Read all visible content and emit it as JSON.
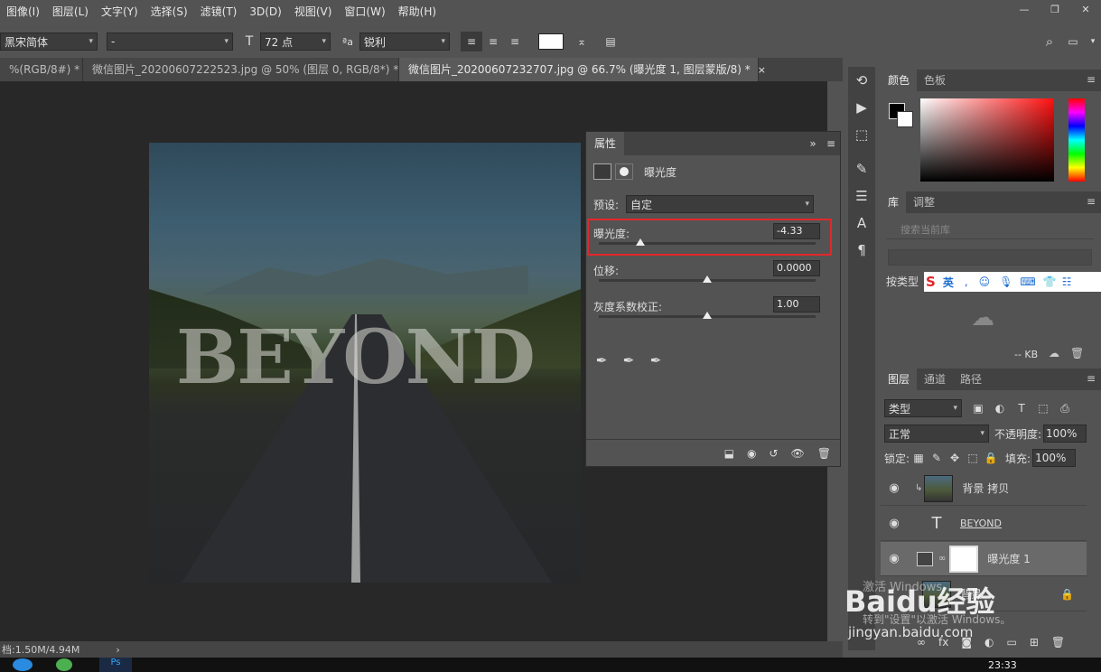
{
  "menubar": {
    "items": [
      "图像(I)",
      "图层(L)",
      "文字(Y)",
      "选择(S)",
      "滤镜(T)",
      "3D(D)",
      "视图(V)",
      "窗口(W)",
      "帮助(H)"
    ]
  },
  "optbar": {
    "font_family": "黑宋简体",
    "font_style": "-",
    "font_size": "72 点",
    "aa_mode": "锐利"
  },
  "tabs": [
    {
      "label": "%(RGB/8#) *"
    },
    {
      "label": "微信图片_20200607222523.jpg @ 50% (图层 0, RGB/8*) *"
    },
    {
      "label": "微信图片_20200607232707.jpg @ 66.7% (曝光度 1, 图层蒙版/8) *"
    }
  ],
  "canvas": {
    "text": "BEYOND"
  },
  "status": {
    "doc": "档:1.50M/4.94M",
    "arrow": "›"
  },
  "properties": {
    "tab": "属性",
    "title": "曝光度",
    "preset_label": "预设:",
    "preset_value": "自定",
    "exposure_label": "曝光度:",
    "exposure_value": "-4.33",
    "exposure_pos": 0.19,
    "offset_label": "位移:",
    "offset_value": "0.0000",
    "offset_pos": 0.5,
    "gamma_label": "灰度系数校正:",
    "gamma_value": "1.00",
    "gamma_pos": 0.5
  },
  "color_panel": {
    "tab_color": "颜色",
    "tab_swatches": "色板"
  },
  "library": {
    "tab_lib": "库",
    "tab_adjust": "调整",
    "search_placeholder": "搜索当前库",
    "sort_label": "按类型",
    "size": "-- KB"
  },
  "ime": {
    "label": "英"
  },
  "layers_panel": {
    "tab_layers": "图层",
    "tab_channels": "通道",
    "tab_paths": "路径",
    "filter_label": "类型",
    "blend_mode": "正常",
    "opacity_label": "不透明度:",
    "opacity_value": "100%",
    "lock_label": "锁定:",
    "fill_label": "填充:",
    "fill_value": "100%",
    "layers": [
      {
        "name": "背景 拷贝"
      },
      {
        "name": "BEYOND"
      },
      {
        "name": "曝光度 1"
      },
      {
        "name": "背景"
      }
    ]
  },
  "watermark": {
    "line1": "激活 Windows",
    "line2": "转到\"设置\"以激活 Windows。",
    "brand": "Baidu经验",
    "url": "jingyan.baidu.com"
  },
  "taskbar": {
    "time": "23:33"
  }
}
